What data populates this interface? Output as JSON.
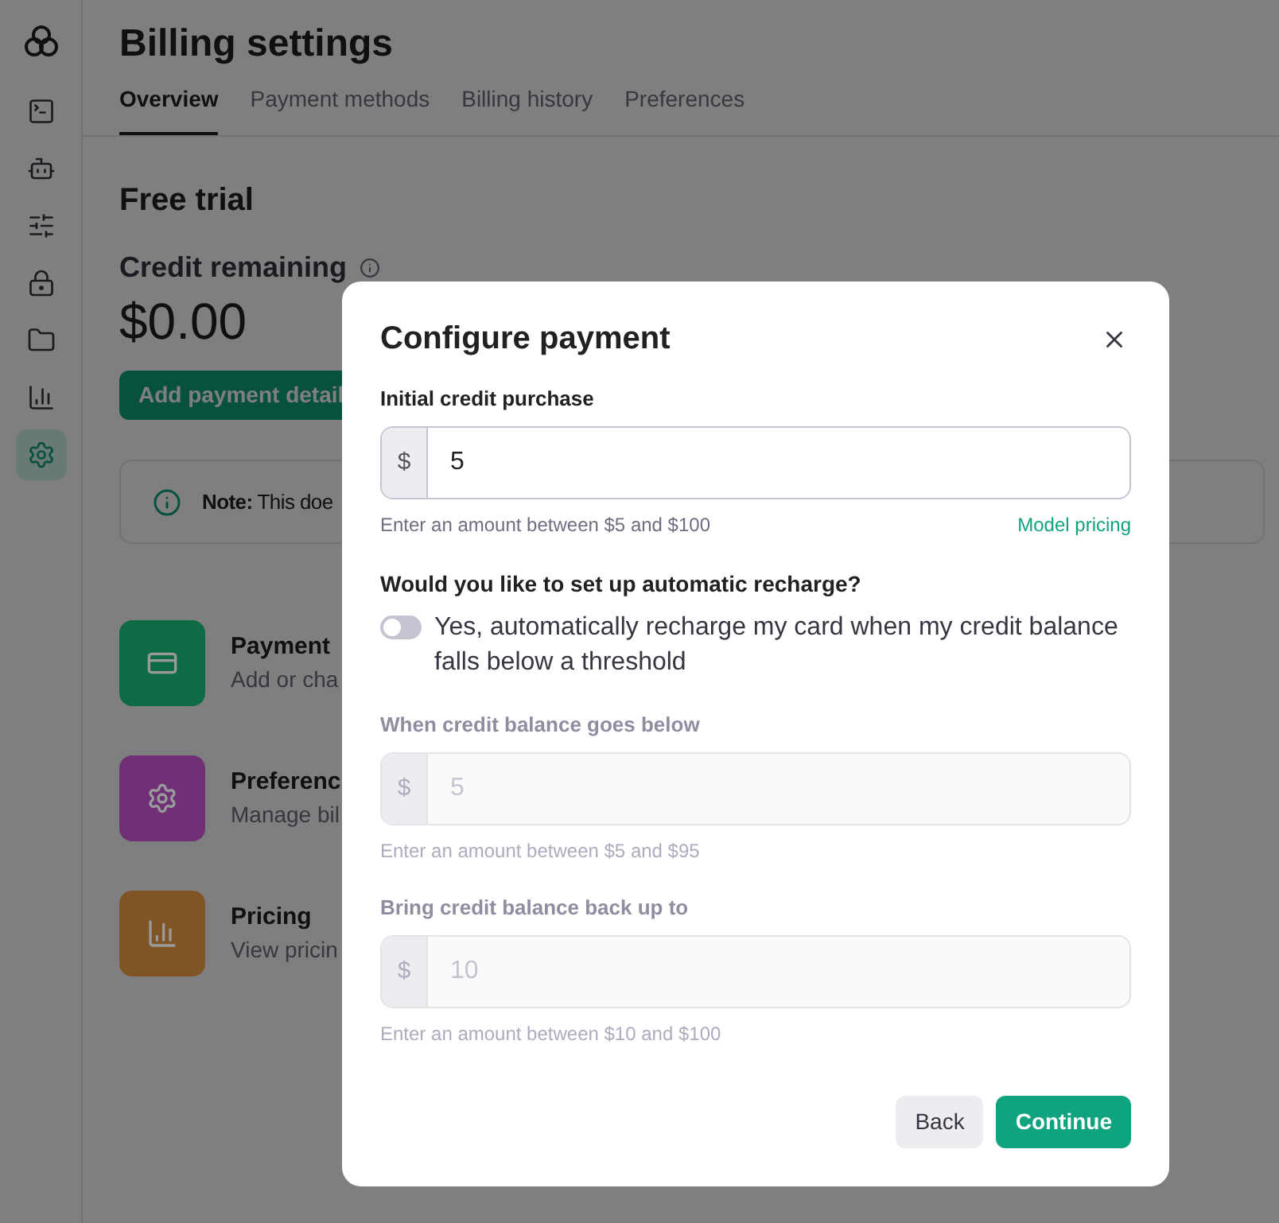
{
  "sidebar": {
    "items": [
      {
        "kind": "terminal",
        "selected": false
      },
      {
        "kind": "assistant",
        "selected": false
      },
      {
        "kind": "sliders",
        "selected": false
      },
      {
        "kind": "lock",
        "selected": false
      },
      {
        "kind": "folder",
        "selected": false
      },
      {
        "kind": "chart",
        "selected": false
      },
      {
        "kind": "settings",
        "selected": true
      }
    ]
  },
  "page": {
    "title": "Billing settings",
    "tabs": [
      {
        "label": "Overview",
        "selected": true
      },
      {
        "label": "Payment methods",
        "selected": false
      },
      {
        "label": "Billing history",
        "selected": false
      },
      {
        "label": "Preferences",
        "selected": false
      }
    ],
    "plan": "Free trial",
    "credit_label": "Credit remaining",
    "credit_amount": "$0.00",
    "add_button": "Add payment detail",
    "note": "**Note:** This doe",
    "cards": [
      {
        "kind": "card",
        "title": "Payment",
        "subtitle": "Add or cha",
        "color": "#0f6b45"
      },
      {
        "kind": "settings",
        "title": "Preferenc",
        "subtitle": "Manage bil",
        "color": "#6f3077"
      },
      {
        "kind": "chart",
        "title": "Pricing",
        "subtitle": "View pricin",
        "color": "#7f5526"
      }
    ]
  },
  "modal": {
    "title": "Configure payment",
    "initial": {
      "label": "Initial credit purchase",
      "prefix": "$",
      "value": "5",
      "disabled": false,
      "hint": "Enter an amount between $5 and $100",
      "link": "Model pricing"
    },
    "question": "Would you like to set up automatic recharge?",
    "auto_recharge": {
      "label": "Yes, automatically recharge my card when my credit balance falls below a threshold",
      "on": false
    },
    "threshold": {
      "label": "When credit balance goes below",
      "prefix": "$",
      "placeholder": "5",
      "disabled": true,
      "hint": "Enter an amount between $5 and $95"
    },
    "target": {
      "label": "Bring credit balance back up to",
      "prefix": "$",
      "placeholder": "10",
      "disabled": true,
      "hint": "Enter an amount between $10 and $100"
    },
    "buttons": [
      {
        "label": "Back",
        "kind": "secondary"
      },
      {
        "label": "Continue",
        "kind": "primary"
      }
    ]
  }
}
